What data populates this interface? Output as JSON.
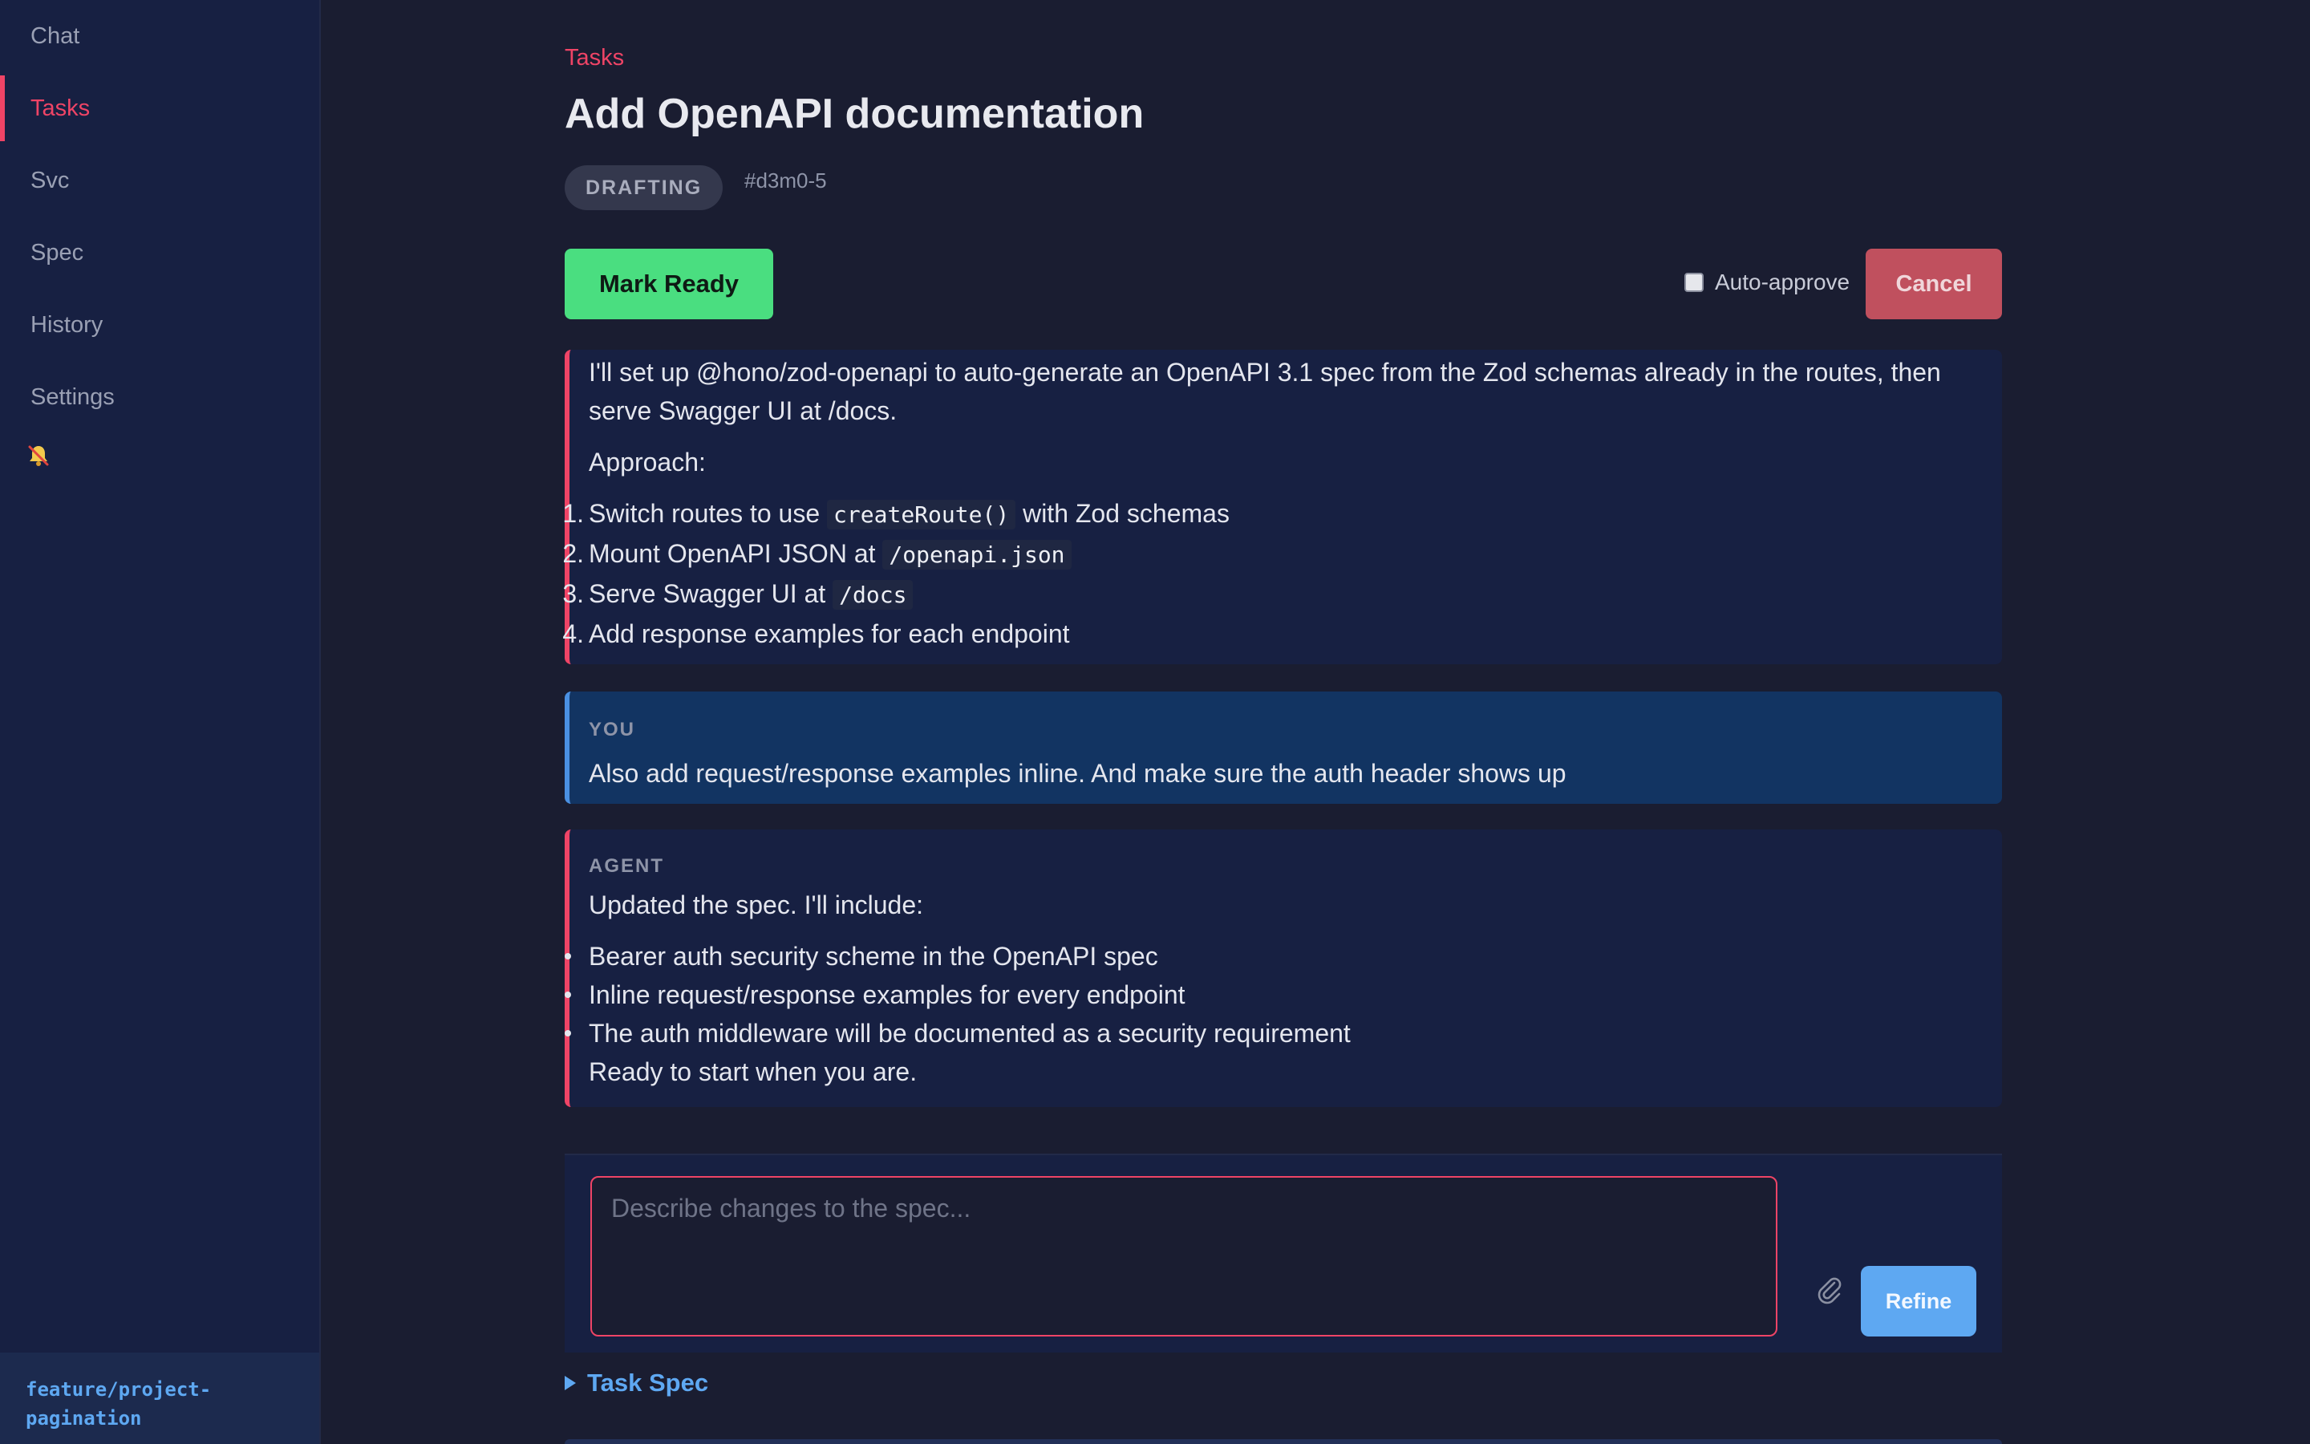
{
  "sidebar": {
    "items": [
      {
        "label": "Chat"
      },
      {
        "label": "Tasks"
      },
      {
        "label": "Svc"
      },
      {
        "label": "Spec"
      },
      {
        "label": "History"
      },
      {
        "label": "Settings"
      }
    ],
    "active": "Tasks",
    "notification_icon": "bell-muted-icon",
    "branch": "feature/project-\npagination"
  },
  "header": {
    "breadcrumb": "Tasks",
    "title": "Add OpenAPI documentation",
    "status": "DRAFTING",
    "task_id": "#d3m0-5"
  },
  "actions": {
    "mark_ready": "Mark Ready",
    "auto_approve_label": "Auto-approve",
    "auto_approve_checked": false,
    "cancel": "Cancel"
  },
  "messages": {
    "agent_plan": {
      "intro": "I'll set up @hono/zod-openapi to auto-generate an OpenAPI 3.1 spec from the Zod schemas already in the routes, then serve Swagger UI at /docs.",
      "approach_label": "Approach:",
      "steps": [
        {
          "num": "1.",
          "before": "Switch routes to use ",
          "code": "createRoute()",
          "after": " with Zod schemas"
        },
        {
          "num": "2.",
          "before": "Mount OpenAPI JSON at ",
          "code": "/openapi.json",
          "after": ""
        },
        {
          "num": "3.",
          "before": "Serve Swagger UI at ",
          "code": "/docs",
          "after": ""
        },
        {
          "num": "4.",
          "before": "Add response examples for each endpoint",
          "code": "",
          "after": ""
        }
      ]
    },
    "user": {
      "label": "YOU",
      "text": "Also add request/response examples inline. And make sure the auth header shows up"
    },
    "agent_update": {
      "label": "AGENT",
      "intro": "Updated the spec. I'll include:",
      "bullets": [
        "Bearer auth security scheme in the OpenAPI spec",
        "Inline request/response examples for every endpoint",
        "The auth middleware will be documented as a security requirement"
      ],
      "outro": "Ready to start when you are."
    }
  },
  "composer": {
    "placeholder": "Describe changes to the spec...",
    "value": "",
    "attach_icon": "paperclip-icon",
    "refine_label": "Refine"
  },
  "task_spec_label": "Task Spec",
  "colors": {
    "accent": "#ef4466",
    "success": "#4ade80",
    "danger": "#c0505e",
    "link": "#5ea8f2",
    "user_bubble": "#123462"
  }
}
